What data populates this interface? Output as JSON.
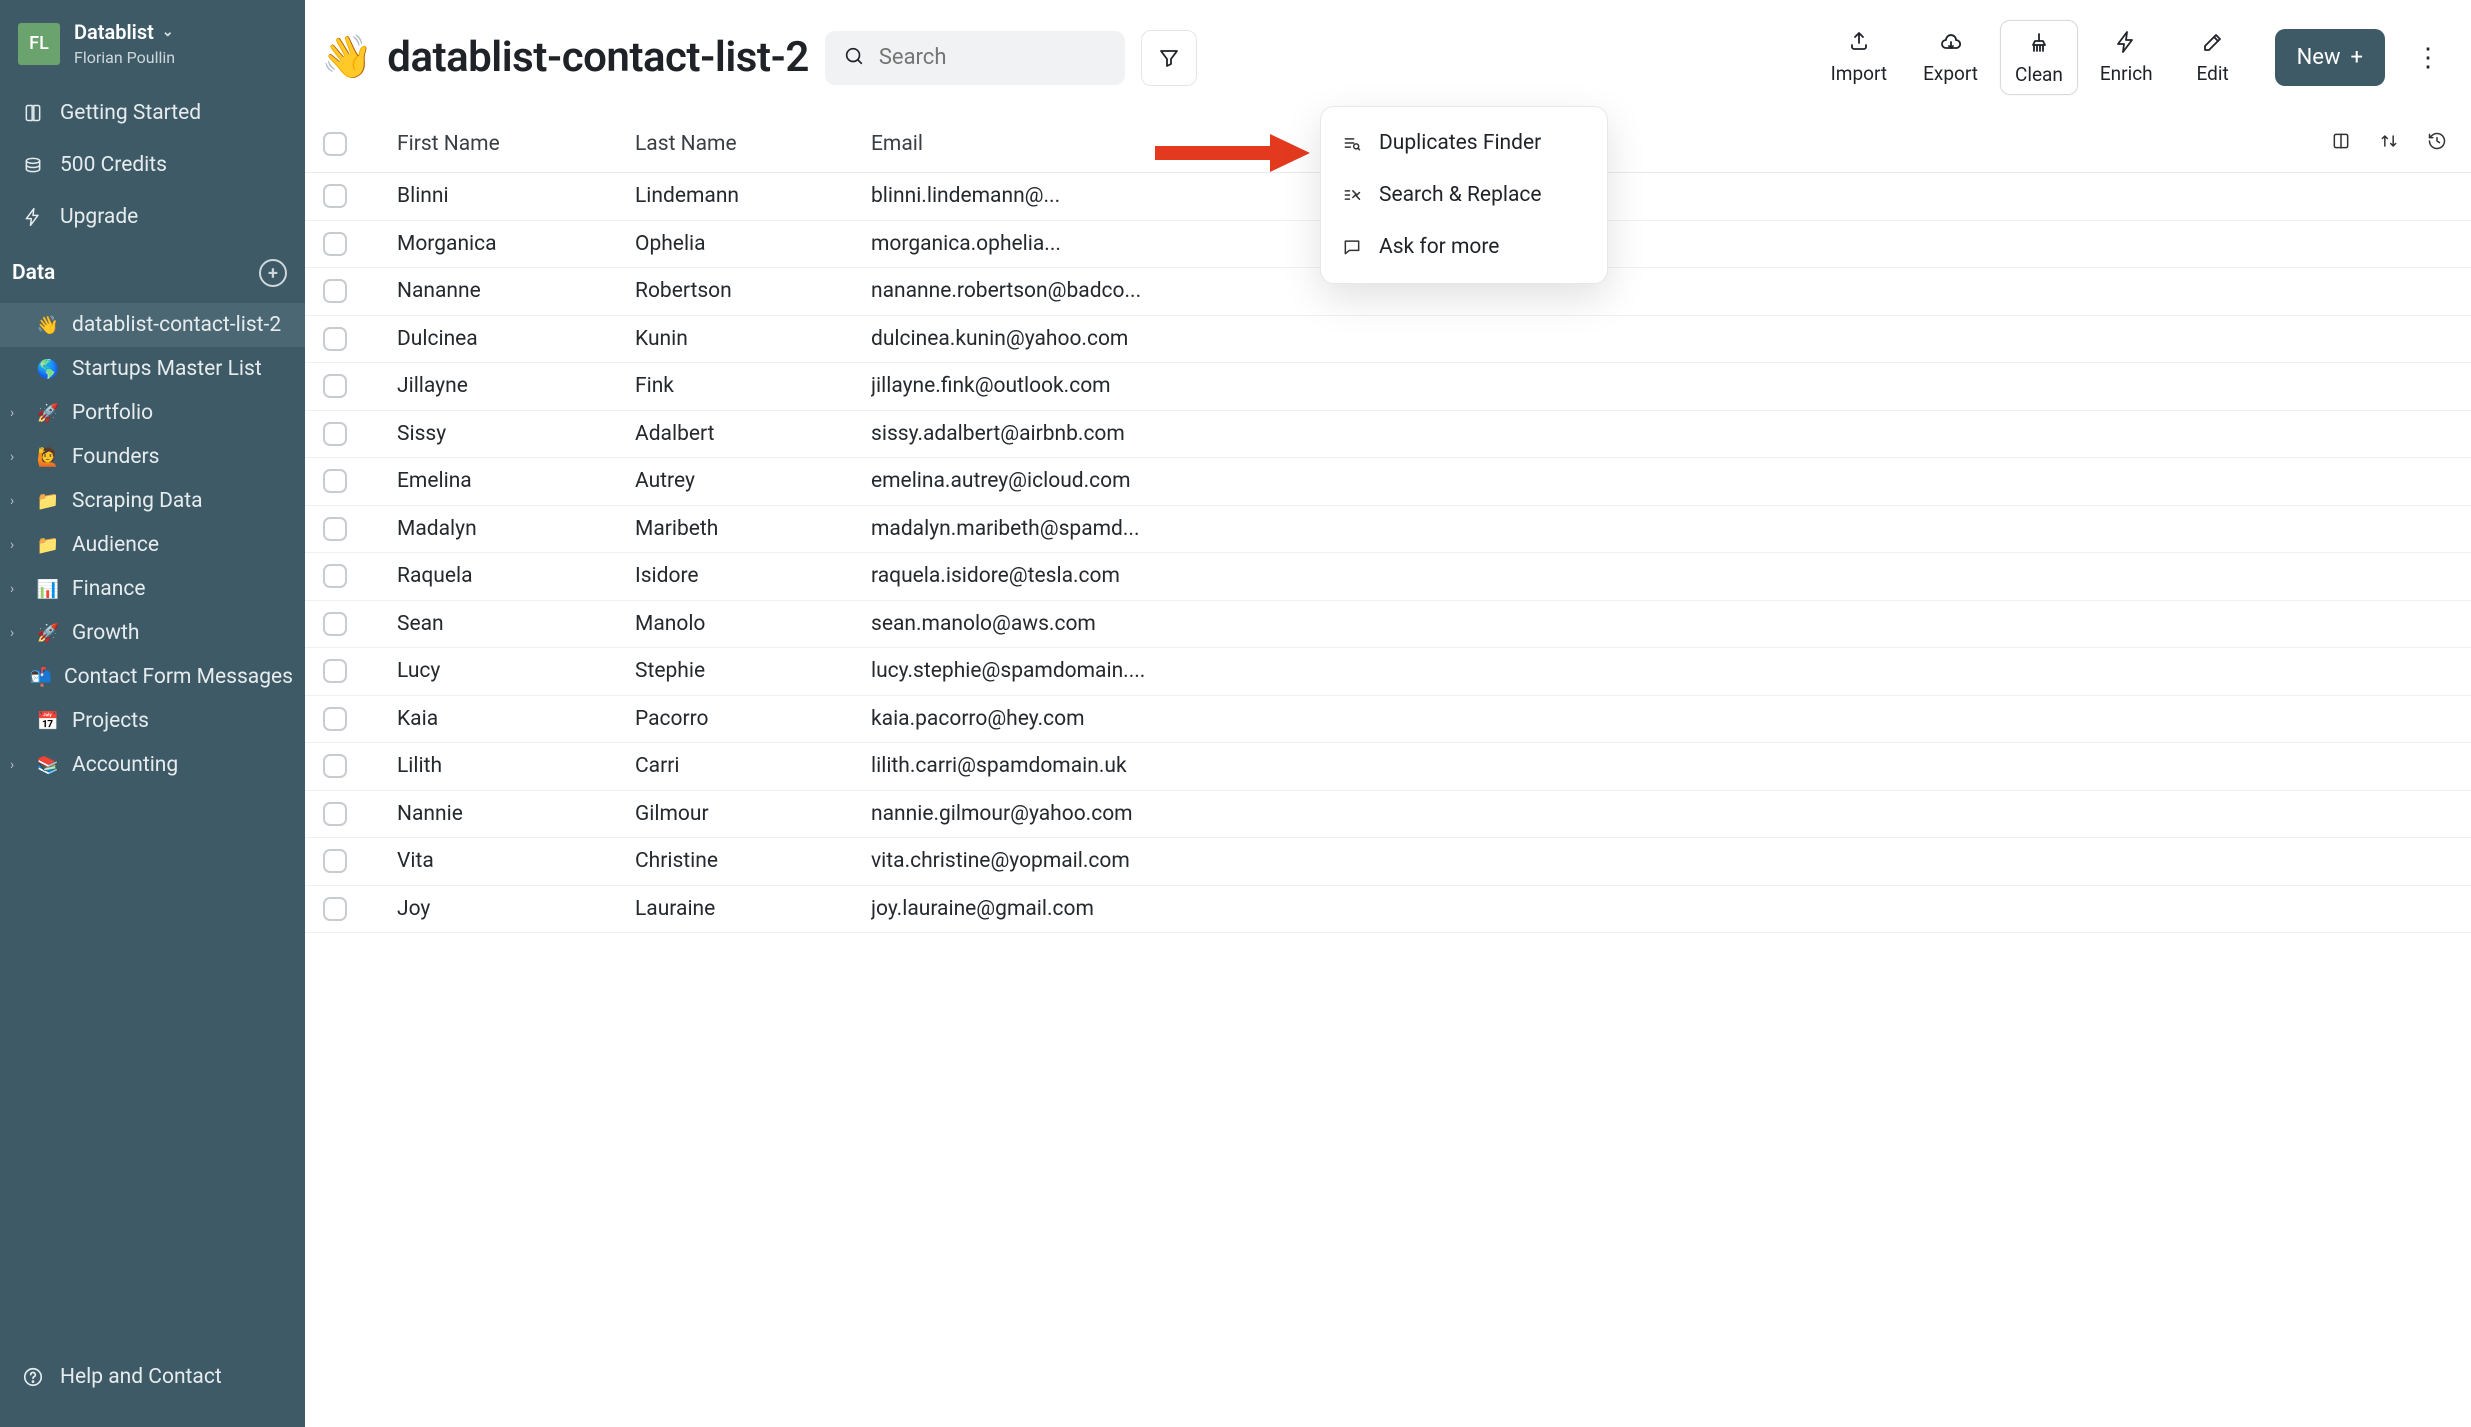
{
  "workspace": {
    "name": "Datablist",
    "user": "Florian Poullin",
    "avatar_initials": "FL"
  },
  "sidebar": {
    "nav": [
      {
        "icon": "book",
        "label": "Getting Started"
      },
      {
        "icon": "coins",
        "label": "500 Credits"
      },
      {
        "icon": "bolt",
        "label": "Upgrade"
      }
    ],
    "section_label": "Data",
    "tree": [
      {
        "emoji": "👋",
        "label": "datablist-contact-list-2",
        "active": true,
        "children": false
      },
      {
        "emoji": "🌎",
        "label": "Startups Master List",
        "children": false
      },
      {
        "emoji": "🚀",
        "label": "Portfolio",
        "children": true
      },
      {
        "emoji": "🙋",
        "label": "Founders",
        "children": true
      },
      {
        "emoji": "📁",
        "label": "Scraping Data",
        "children": true
      },
      {
        "emoji": "📁",
        "label": "Audience",
        "children": true
      },
      {
        "emoji": "📊",
        "label": "Finance",
        "children": true
      },
      {
        "emoji": "🚀",
        "label": "Growth",
        "children": true
      },
      {
        "emoji": "📬",
        "label": "Contact Form Messages",
        "children": false
      },
      {
        "emoji": "📅",
        "label": "Projects",
        "children": false
      },
      {
        "emoji": "📚",
        "label": "Accounting",
        "children": true
      }
    ],
    "footer": {
      "icon": "help",
      "label": "Help and Contact"
    }
  },
  "header": {
    "emoji": "👋",
    "title": "datablist-contact-list-2",
    "search_placeholder": "Search",
    "actions": [
      {
        "key": "import",
        "label": "Import"
      },
      {
        "key": "export",
        "label": "Export"
      },
      {
        "key": "clean",
        "label": "Clean",
        "active": true
      },
      {
        "key": "enrich",
        "label": "Enrich"
      },
      {
        "key": "edit",
        "label": "Edit"
      }
    ],
    "new_label": "New"
  },
  "clean_menu": [
    {
      "icon": "dupes",
      "label": "Duplicates Finder"
    },
    {
      "icon": "search",
      "label": "Search & Replace"
    },
    {
      "icon": "chat",
      "label": "Ask for more"
    }
  ],
  "table": {
    "columns": [
      "First Name",
      "Last Name",
      "Email"
    ],
    "rows": [
      {
        "first": "Blinni",
        "last": "Lindemann",
        "email": "blinni.lindemann@..."
      },
      {
        "first": "Morganica",
        "last": "Ophelia",
        "email": "morganica.ophelia..."
      },
      {
        "first": "Nananne",
        "last": "Robertson",
        "email": "nananne.robertson@badco..."
      },
      {
        "first": "Dulcinea",
        "last": "Kunin",
        "email": "dulcinea.kunin@yahoo.com"
      },
      {
        "first": "Jillayne",
        "last": "Fink",
        "email": "jillayne.fink@outlook.com"
      },
      {
        "first": "Sissy",
        "last": "Adalbert",
        "email": "sissy.adalbert@airbnb.com"
      },
      {
        "first": "Emelina",
        "last": "Autrey",
        "email": "emelina.autrey@icloud.com"
      },
      {
        "first": "Madalyn",
        "last": "Maribeth",
        "email": "madalyn.maribeth@spamd..."
      },
      {
        "first": "Raquela",
        "last": "Isidore",
        "email": "raquela.isidore@tesla.com"
      },
      {
        "first": "Sean",
        "last": "Manolo",
        "email": "sean.manolo@aws.com"
      },
      {
        "first": "Lucy",
        "last": "Stephie",
        "email": "lucy.stephie@spamdomain...."
      },
      {
        "first": "Kaia",
        "last": "Pacorro",
        "email": "kaia.pacorro@hey.com"
      },
      {
        "first": "Lilith",
        "last": "Carri",
        "email": "lilith.carri@spamdomain.uk"
      },
      {
        "first": "Nannie",
        "last": "Gilmour",
        "email": "nannie.gilmour@yahoo.com"
      },
      {
        "first": "Vita",
        "last": "Christine",
        "email": "vita.christine@yopmail.com"
      },
      {
        "first": "Joy",
        "last": "Lauraine",
        "email": "joy.lauraine@gmail.com"
      }
    ]
  }
}
